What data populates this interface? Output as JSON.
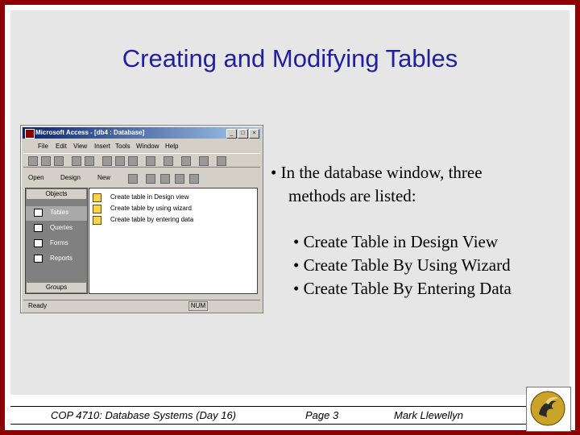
{
  "slide": {
    "title": "Creating and Modifying Tables",
    "bullet_main_line1": "• In the database window, three",
    "bullet_main_line2": "methods are listed:",
    "sub_bullets": [
      "• Create Table in Design View",
      "• Create Table By Using Wizard",
      "• Create Table By Entering Data"
    ]
  },
  "access_window": {
    "title": "Microsoft Access - [db4 : Database]",
    "menu": [
      "File",
      "Edit",
      "View",
      "Insert",
      "Tools",
      "Window",
      "Help"
    ],
    "db_toolbar": [
      "Open",
      "Design",
      "New"
    ],
    "objects_header": "Objects",
    "objects": [
      "Tables",
      "Queries",
      "Forms",
      "Reports"
    ],
    "groups_label": "Groups",
    "list_items": [
      "Create table in Design view",
      "Create table by using wizard",
      "Create table by entering data"
    ],
    "status": "Ready",
    "status_num": "NUM"
  },
  "footer": {
    "course": "COP 4710: Database Systems  (Day 16)",
    "page": "Page 3",
    "author": "Mark Llewellyn"
  },
  "colors": {
    "title": "#1f1f9f",
    "border": "#8b0000",
    "background": "#e6e6e6"
  }
}
